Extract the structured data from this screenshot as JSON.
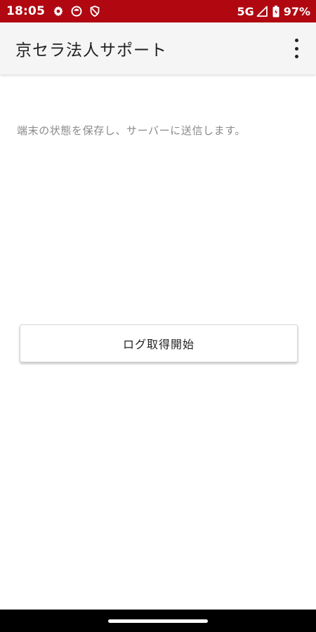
{
  "status_bar": {
    "time": "18:05",
    "icons": [
      "gear-icon",
      "notification-icon",
      "shield-icon"
    ],
    "network": "5G",
    "battery_percent": "97%",
    "background_color": "#b00711"
  },
  "app_bar": {
    "title": "京セラ法人サポート",
    "menu_icon": "more-vert-icon"
  },
  "main": {
    "description": "端末の状態を保存し、サーバーに送信します。",
    "start_button_label": "ログ取得開始"
  },
  "nav_bar": {
    "home_handle": "home-handle"
  }
}
